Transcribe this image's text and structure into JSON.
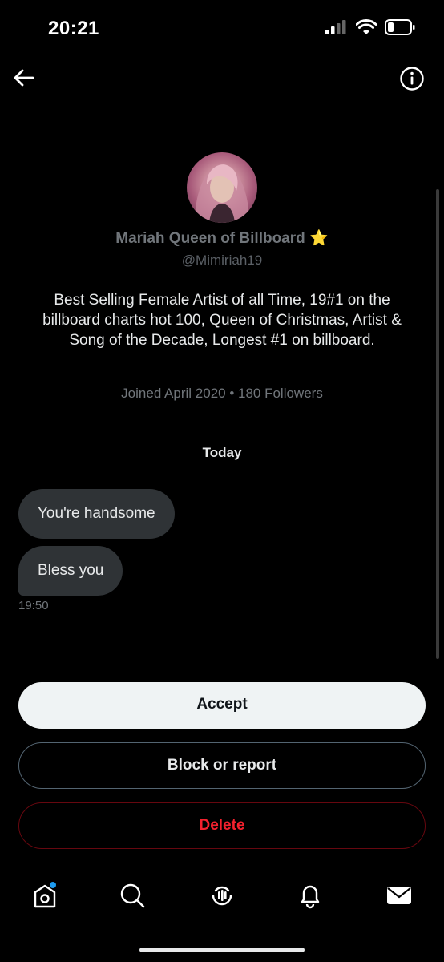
{
  "status_bar": {
    "time": "20:21"
  },
  "header": {
    "back_icon": "arrow-left-icon",
    "info_icon": "info-icon"
  },
  "profile": {
    "name": "Mariah Queen of Billboard",
    "name_emoji": "⭐",
    "handle": "@Mimiriah19",
    "bio": "Best Selling Female Artist of all Time, 19#1 on the billboard charts hot 100, Queen of Christmas, Artist & Song of the Decade, Longest #1 on billboard.",
    "joined": "Joined April 2020 • 180 Followers"
  },
  "conversation": {
    "date_label": "Today",
    "messages": [
      {
        "text": "You're handsome"
      },
      {
        "text": "Bless you"
      }
    ],
    "last_time": "19:50"
  },
  "actions": {
    "accept": "Accept",
    "block_report": "Block or report",
    "delete": "Delete"
  },
  "colors": {
    "background": "#000000",
    "bubble": "#2f3336",
    "accept_bg": "#eff3f4",
    "delete_red": "#f4212e",
    "notification_dot": "#1d9bf0"
  },
  "tab_bar": {
    "items": [
      "home-icon",
      "search-icon",
      "spaces-icon",
      "notifications-icon",
      "messages-icon"
    ]
  }
}
